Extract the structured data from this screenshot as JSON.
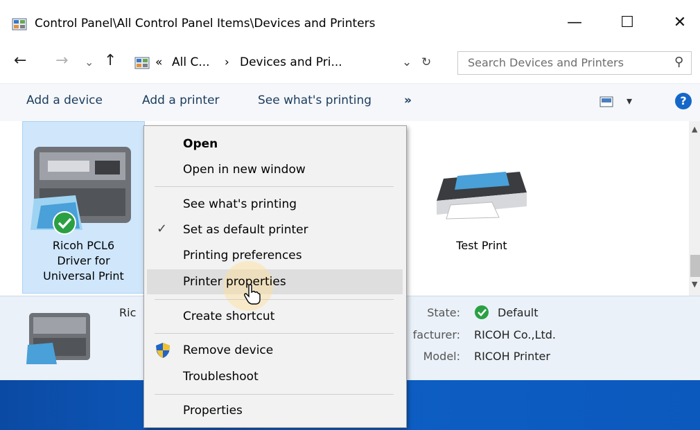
{
  "window": {
    "title": "Control Panel\\All Control Panel Items\\Devices and Printers",
    "minimize_glyph": "—",
    "maximize_glyph": "☐",
    "close_glyph": "✕"
  },
  "address": {
    "back_glyph": "←",
    "forward_glyph": "→",
    "recent_glyph": "⌄",
    "up_glyph": "↑",
    "overflow": "«",
    "crumb1": "All C...",
    "crumb_sep": "›",
    "crumb2": "Devices and Pri...",
    "dropdown_glyph": "⌄",
    "refresh_glyph": "↻",
    "search_placeholder": "Search Devices and Printers",
    "search_glyph": "⚲"
  },
  "commands": {
    "add_device": "Add a device",
    "add_printer": "Add a printer",
    "see_printing": "See what's printing",
    "more": "»",
    "view_caret": "▾",
    "help": "?"
  },
  "devices": [
    {
      "label_line1": "Ricoh PCL6",
      "label_line2": "Driver for",
      "label_line3": "Universal Print",
      "default": true
    },
    {
      "label": "Test Print"
    }
  ],
  "details": {
    "name_partial": "Ric",
    "state_label": "State:",
    "state_value": "Default",
    "manufacturer_label": "facturer:",
    "manufacturer_value": "RICOH Co.,Ltd.",
    "model_label": "Model:",
    "model_value": "RICOH Printer"
  },
  "context_menu": {
    "open": "Open",
    "open_new_window": "Open in new window",
    "see_whats_printing": "See what's printing",
    "set_default": "Set as default printer",
    "check_glyph": "✓",
    "printing_preferences": "Printing preferences",
    "printer_properties": "Printer properties",
    "create_shortcut": "Create shortcut",
    "remove_device": "Remove device",
    "troubleshoot": "Troubleshoot",
    "properties": "Properties"
  },
  "colors": {
    "selection_bg": "#cfe6fb",
    "details_bg": "#eaf1f9",
    "default_green": "#2aa043",
    "help_blue": "#1467c8"
  }
}
